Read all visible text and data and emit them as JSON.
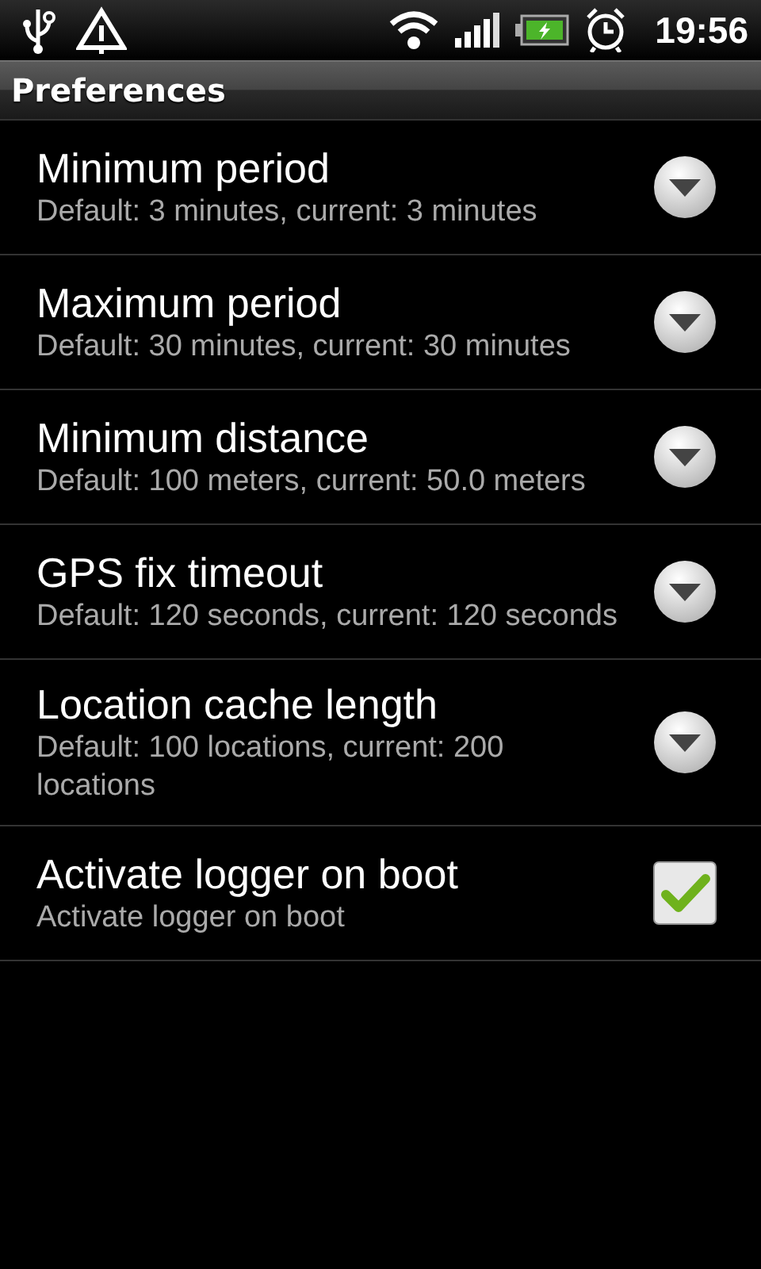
{
  "status_bar": {
    "time": "19:56"
  },
  "title": "Preferences",
  "preferences": [
    {
      "kind": "list",
      "title": "Minimum period",
      "summary": "Default: 3 minutes, current: 3 minutes"
    },
    {
      "kind": "list",
      "title": "Maximum period",
      "summary": "Default: 30 minutes, current: 30 minutes"
    },
    {
      "kind": "list",
      "title": "Minimum distance",
      "summary": "Default: 100 meters, current: 50.0 meters"
    },
    {
      "kind": "list",
      "title": "GPS fix timeout",
      "summary": "Default: 120 seconds, current: 120 seconds"
    },
    {
      "kind": "list",
      "title": "Location cache length",
      "summary": "Default: 100 locations, current: 200 locations"
    },
    {
      "kind": "checkbox",
      "title": "Activate logger on boot",
      "summary": "Activate logger on boot",
      "checked": true
    }
  ]
}
